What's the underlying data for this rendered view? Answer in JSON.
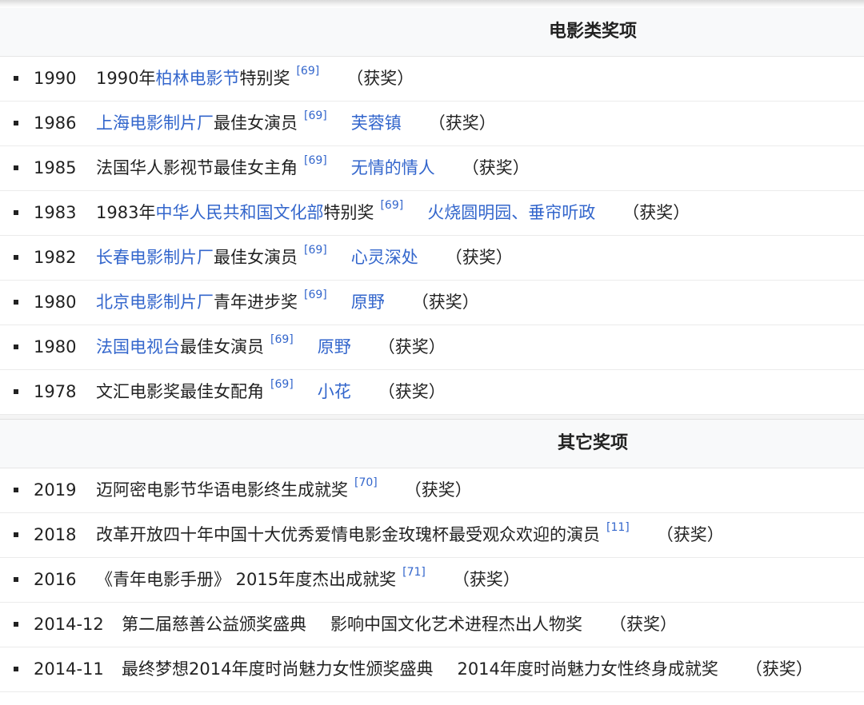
{
  "film_section": {
    "title": "电影类奖项",
    "rows": [
      {
        "year": "1990",
        "award_pre": "1990年",
        "award_link": "柏林电影节",
        "award_post": "特别奖",
        "ref": "[69]",
        "work": "",
        "result": "（获奖）"
      },
      {
        "year": "1986",
        "award_pre": "",
        "award_link": "上海电影制片厂",
        "award_post": "最佳女演员",
        "ref": "[69]",
        "work": "芙蓉镇",
        "result": "（获奖）"
      },
      {
        "year": "1985",
        "award_pre": "法国华人影视节最佳女主角",
        "award_link": "",
        "award_post": "",
        "ref": "[69]",
        "work": "无情的情人",
        "result": "（获奖）"
      },
      {
        "year": "1983",
        "award_pre": "1983年",
        "award_link": "中华人民共和国文化部",
        "award_post": "特别奖",
        "ref": "[69]",
        "work": "火烧圆明园、垂帘听政",
        "result": "（获奖）"
      },
      {
        "year": "1982",
        "award_pre": "",
        "award_link": "长春电影制片厂",
        "award_post": "最佳女演员",
        "ref": "[69]",
        "work": "心灵深处",
        "result": "（获奖）"
      },
      {
        "year": "1980",
        "award_pre": "",
        "award_link": "北京电影制片厂",
        "award_post": "青年进步奖",
        "ref": "[69]",
        "work": "原野",
        "result": "（获奖）"
      },
      {
        "year": "1980",
        "award_pre": "",
        "award_link": "法国电视台",
        "award_post": "最佳女演员",
        "ref": "[69]",
        "work": "原野",
        "result": "（获奖）"
      },
      {
        "year": "1978",
        "award_pre": "文汇电影奖最佳女配角",
        "award_link": "",
        "award_post": "",
        "ref": "[69]",
        "work": "小花",
        "result": "（获奖）"
      }
    ]
  },
  "other_section": {
    "title": "其它奖项",
    "rows": [
      {
        "year": "2019",
        "award": "迈阿密电影节华语电影终生成就奖",
        "ref": "[70]",
        "work": "",
        "result": "（获奖）"
      },
      {
        "year": "2018",
        "award": "改革开放四十年中国十大优秀爱情电影金玫瑰杯最受观众欢迎的演员",
        "ref": "[11]",
        "work": "",
        "result": "（获奖）"
      },
      {
        "year": "2016",
        "award": "《青年电影手册》 2015年度杰出成就奖",
        "ref": "[71]",
        "work": "",
        "result": "（获奖）"
      },
      {
        "year": "2014-12",
        "award": "第二届慈善公益颁奖盛典",
        "ref": "",
        "work": "影响中国文化艺术进程杰出人物奖",
        "result": "（获奖）"
      },
      {
        "year": "2014-11",
        "award": "最终梦想2014年度时尚魅力女性颁奖盛典",
        "ref": "",
        "work": "2014年度时尚魅力女性终身成就奖",
        "result": "（获奖）"
      }
    ]
  }
}
